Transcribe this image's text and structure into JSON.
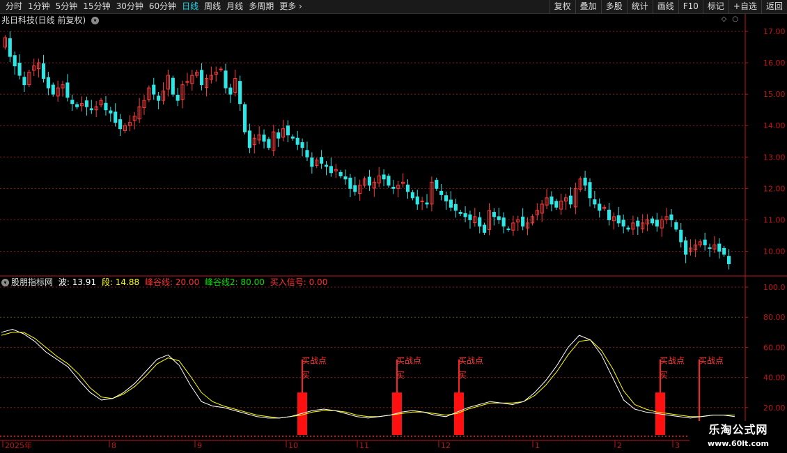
{
  "toolbar": {
    "periods": [
      "分时",
      "1分钟",
      "5分钟",
      "15分钟",
      "30分钟",
      "60分钟",
      "日线",
      "周线",
      "月线",
      "多周期",
      "更多"
    ],
    "active_period": "日线",
    "actions": [
      "复权",
      "叠加",
      "多股",
      "统计",
      "画线",
      "F10",
      "标记",
      "+自选",
      "返回"
    ]
  },
  "main_panel": {
    "title": "兆日科技(日线 前复权)",
    "y_ticks": [
      "17.00",
      "16.00",
      "15.00",
      "14.00",
      "13.00",
      "12.00",
      "11.00",
      "10.00"
    ]
  },
  "indicator_panel": {
    "name": "股朋指标网",
    "legend": [
      {
        "label": "波:",
        "value": "13.91",
        "color": "#ffffff"
      },
      {
        "label": "段:",
        "value": "14.88",
        "color": "#ffff00"
      },
      {
        "label": "峰谷线:",
        "value": "20.00",
        "color": "#ff3030"
      },
      {
        "label": "峰谷线2:",
        "value": "80.00",
        "color": "#00e000"
      },
      {
        "label": "买入信号:",
        "value": "0.00",
        "color": "#ff3030"
      }
    ],
    "y_ticks": [
      "100.0",
      "80.00",
      "60.00",
      "40.00",
      "20.00"
    ],
    "signal_text": "买战点",
    "signal_buy": "买"
  },
  "x_axis": {
    "labels": [
      "2025年",
      "8",
      "9",
      "10",
      "11",
      "12",
      "1",
      "2",
      "3"
    ]
  },
  "colors": {
    "up": "#ff3c3c",
    "down": "#2ee6e6",
    "grid": "#8a1a1a",
    "axis": "#c01818",
    "bo_line": "#ffffff",
    "duan_line": "#ffff00"
  },
  "chart_data": [
    {
      "type": "candlestick",
      "title": "兆日科技(日线 前复权)",
      "ylim": [
        9.3,
        17.2
      ],
      "close": [
        16.8,
        16.2,
        15.9,
        15.6,
        15.3,
        15.7,
        15.9,
        16.0,
        15.5,
        15.2,
        15.0,
        15.2,
        15.3,
        14.9,
        14.7,
        14.6,
        14.7,
        14.6,
        14.5,
        14.6,
        14.8,
        14.5,
        14.4,
        14.1,
        13.9,
        14.0,
        14.1,
        14.3,
        14.6,
        14.8,
        15.2,
        15.0,
        14.8,
        15.1,
        15.6,
        15.0,
        14.8,
        15.3,
        15.4,
        15.6,
        15.7,
        15.3,
        15.5,
        15.6,
        15.7,
        15.8,
        15.2,
        15.0,
        15.5,
        14.7,
        13.8,
        13.3,
        13.6,
        13.7,
        13.5,
        13.3,
        13.8,
        13.6,
        13.9,
        13.7,
        13.6,
        13.4,
        13.3,
        13.0,
        12.7,
        12.9,
        12.8,
        12.7,
        12.5,
        12.6,
        12.4,
        12.3,
        12.0,
        11.9,
        12.1,
        12.3,
        12.1,
        12.2,
        12.4,
        12.3,
        12.1,
        12.0,
        12.1,
        12.2,
        11.9,
        11.7,
        11.5,
        11.6,
        11.5,
        12.2,
        12.0,
        11.8,
        11.6,
        11.4,
        11.3,
        11.2,
        11.1,
        11.0,
        11.1,
        10.8,
        10.6,
        11.3,
        11.1,
        11.0,
        10.8,
        10.7,
        10.9,
        11.0,
        10.8,
        10.9,
        11.1,
        11.3,
        11.5,
        11.7,
        11.5,
        11.4,
        11.6,
        11.7,
        11.5,
        12.0,
        12.3,
        12.1,
        11.7,
        11.5,
        11.3,
        11.4,
        11.0,
        11.1,
        10.9,
        10.8,
        10.7,
        10.9,
        10.8,
        10.9,
        11.0,
        10.9,
        10.8,
        11.0,
        11.1,
        11.0,
        10.7,
        10.3,
        9.9,
        10.1,
        10.2,
        10.3,
        10.2,
        10.1,
        10.2,
        10.0,
        9.9,
        9.6
      ]
    },
    {
      "type": "line",
      "title": "股朋指标网",
      "ylim": [
        0,
        100
      ],
      "x": [
        "2025年",
        "8",
        "9",
        "10",
        "11",
        "12",
        "1",
        "2",
        "3"
      ],
      "series": [
        {
          "name": "波",
          "values": [
            70,
            72,
            69,
            64,
            57,
            52,
            47,
            38,
            30,
            25,
            26,
            30,
            36,
            44,
            52,
            55,
            48,
            35,
            24,
            21,
            20,
            18,
            16,
            14,
            13,
            13,
            14,
            16,
            18,
            19,
            18,
            16,
            14,
            13,
            14,
            15,
            17,
            18,
            17,
            15,
            14,
            17,
            20,
            22,
            24,
            23,
            22,
            24,
            30,
            38,
            48,
            60,
            68,
            65,
            55,
            40,
            25,
            19,
            17,
            16,
            15,
            14,
            13,
            14,
            15,
            15,
            14
          ],
          "current": 13.91
        },
        {
          "name": "段",
          "values": [
            68,
            70,
            70,
            66,
            60,
            54,
            49,
            42,
            33,
            27,
            26,
            29,
            34,
            41,
            49,
            53,
            51,
            41,
            30,
            24,
            21,
            19,
            17,
            15,
            14,
            13,
            14,
            15,
            17,
            18,
            18,
            17,
            15,
            14,
            14,
            15,
            16,
            17,
            17,
            16,
            15,
            16,
            19,
            21,
            23,
            23,
            23,
            24,
            28,
            35,
            44,
            55,
            64,
            65,
            58,
            46,
            31,
            22,
            19,
            17,
            16,
            15,
            14,
            14,
            15,
            15,
            15
          ],
          "current": 14.88
        },
        {
          "name": "峰谷线",
          "values": [
            20
          ],
          "current": 20.0
        },
        {
          "name": "峰谷线2",
          "values": [
            80
          ],
          "current": 80.0
        },
        {
          "name": "买入信号",
          "values": [
            0
          ],
          "current": 0.0
        }
      ],
      "signals": [
        {
          "label": "买战点",
          "sub": "买",
          "bar_value": 30
        },
        {
          "label": "买战点",
          "sub": "买",
          "bar_value": 30
        },
        {
          "label": "买战点",
          "sub": "买",
          "bar_value": 30
        },
        {
          "label": "买战点",
          "sub": "买",
          "bar_value": 30
        },
        {
          "label": "买战点",
          "sub": "",
          "bar_value": 0
        }
      ]
    }
  ]
}
